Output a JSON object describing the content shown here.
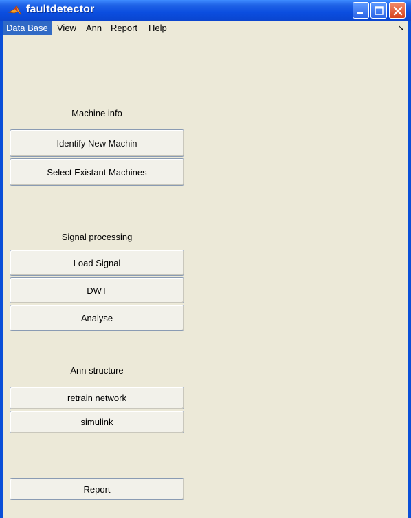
{
  "window": {
    "title": "faultdetector"
  },
  "menu": {
    "items": [
      "Data Base",
      "View",
      "Ann",
      "Report",
      "Help"
    ],
    "active": "Data Base",
    "arrow_glyph": "↘"
  },
  "sections": {
    "machine": {
      "label": "Machine info",
      "buttons": [
        "Identify New Machin",
        "Select Existant Machines"
      ]
    },
    "signal": {
      "label": "Signal processing",
      "buttons": [
        "Load Signal",
        "DWT",
        "Analyse"
      ]
    },
    "ann": {
      "label": "Ann structure",
      "buttons": [
        "retrain network",
        "simulink"
      ]
    },
    "report": {
      "buttons": [
        "Report"
      ]
    }
  },
  "colors": {
    "title_bar": "#0b4ee0",
    "panel": "#ece9d8",
    "menu_highlight": "#316ac5",
    "close_button": "#d7421c"
  }
}
